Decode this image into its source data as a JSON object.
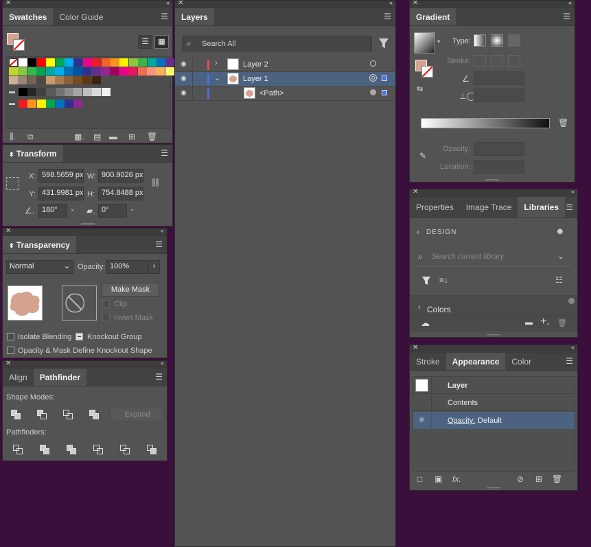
{
  "swatches": {
    "tabs": [
      "Swatches",
      "Color Guide"
    ],
    "row1": [
      "#ffffff",
      "#000000",
      "#ff0000",
      "#ffff00",
      "#00a651",
      "#00aeef",
      "#2e3192",
      "#ec008c",
      "#ed1c24",
      "#f26522",
      "#f7941d",
      "#fff200",
      "#8dc63f",
      "#39b54a",
      "#00a99d",
      "#0072bc",
      "#662d91",
      "#9e005d"
    ],
    "row2": [
      "#c2d62e",
      "#8dc63f",
      "#39b54a",
      "#00a651",
      "#00a99d",
      "#00aeef",
      "#0072bc",
      "#0054a6",
      "#2e3192",
      "#662d91",
      "#92278f",
      "#9e005d",
      "#ec008c",
      "#ed145b",
      "#f26c4f",
      "#f7977a",
      "#fbaf5d",
      "#fff568"
    ],
    "row3": [
      "#c7b299",
      "#998675",
      "#736357",
      "#534741",
      "#c69c6d",
      "#a67c52",
      "#8c6239",
      "#754c24",
      "#603913",
      "#3c2415"
    ],
    "row4": [
      "#000000",
      "#262626",
      "#404040",
      "#595959",
      "#737373",
      "#8c8c8c",
      "#a6a6a6",
      "#bfbfbf",
      "#d9d9d9",
      "#f2f2f2"
    ],
    "row5": [
      "#ed1c24",
      "#f7941d",
      "#fff200",
      "#00a651",
      "#0072bc",
      "#2e3192",
      "#92278f"
    ]
  },
  "transform": {
    "tab": "Transform",
    "x_label": "X:",
    "x_value": "598.5659 px",
    "y_label": "Y:",
    "y_value": "431.9981 px",
    "w_label": "W:",
    "w_value": "900.9026 px",
    "h_label": "H:",
    "h_value": "754.8488 px",
    "angle_value": "180°",
    "shear_value": "0°"
  },
  "transparency": {
    "tab": "Transparency",
    "mode": "Normal",
    "opacity_label": "Opacity:",
    "opacity_value": "100%",
    "make_mask": "Make Mask",
    "clip": "Clip",
    "invert_mask": "Invert Mask",
    "isolate_blending": "Isolate Blending",
    "knockout_group": "Knockout Group",
    "opacity_mask": "Opacity & Mask Define Knockout Shape"
  },
  "pathfinder": {
    "tabs": [
      "Align",
      "Pathfinder"
    ],
    "shape_modes": "Shape Modes:",
    "expand": "Expand",
    "pathfinders": "Pathfinders:"
  },
  "layers": {
    "tab": "Layers",
    "search_placeholder": "Search All",
    "rows": [
      {
        "name": "Layer 2",
        "color": "#e84a4a"
      },
      {
        "name": "Layer 1",
        "color": "#4a6fe8"
      },
      {
        "name": "<Path>",
        "color": "#4a6fe8"
      }
    ]
  },
  "gradient": {
    "tab": "Gradient",
    "type_label": "Type:",
    "stroke_label": "Stroke:",
    "opacity_label": "Opacity:",
    "location_label": "Location:"
  },
  "libraries": {
    "tabs": [
      "Properties",
      "Image Trace",
      "Libraries"
    ],
    "design": "DESIGN",
    "search_placeholder": "Search current library",
    "colors": "Colors"
  },
  "appearance": {
    "tabs": [
      "Stroke",
      "Appearance",
      "Color"
    ],
    "layer": "Layer",
    "contents": "Contents",
    "opacity_label": "Opacity:",
    "opacity_value": "Default"
  },
  "colors": {
    "fill_swatch": "#d4a38e",
    "selected_row": "#4b6380",
    "panel": "#535353"
  }
}
